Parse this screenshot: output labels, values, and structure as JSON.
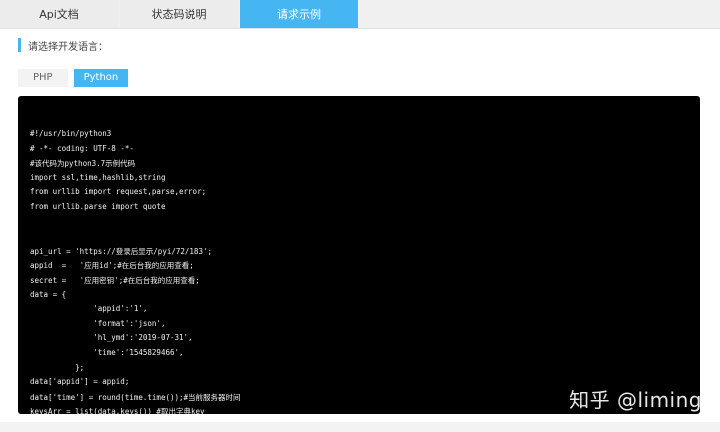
{
  "tabs": [
    {
      "label": "Api文档"
    },
    {
      "label": "状态码说明"
    },
    {
      "label": "请求示例",
      "active": true
    }
  ],
  "section_title": "请选择开发语言：",
  "languages": [
    {
      "label": "PHP",
      "active": false
    },
    {
      "label": "Python",
      "active": true
    }
  ],
  "code_lines": [
    "#!/usr/bin/python3",
    "# -*- coding: UTF-8 -*-",
    "#该代码为python3.7示例代码",
    "import ssl,time,hashlib,string",
    "from urllib import request,parse,error;",
    "from urllib.parse import quote",
    "",
    "",
    "api_url = 'https://登录后显示/pyi/72/183';",
    "appid  =   '应用id';#在后台我的应用查看;",
    "secret =   '应用密钥';#在后台我的应用查看;",
    "data = {",
    "              'appid':'1',",
    "              'format':'json',",
    "              'hl_ymd':'2019-07-31',",
    "              'time':'1545829466',",
    "          };",
    "data['appid'] = appid;",
    "data['time'] = round(time.time());#当前服务器时间",
    "keysArr = list(data.keys()) #取出字典key"
  ],
  "watermark": "知乎 @liming",
  "colors": {
    "accent": "#45b6f2",
    "code_bg": "#000000"
  }
}
